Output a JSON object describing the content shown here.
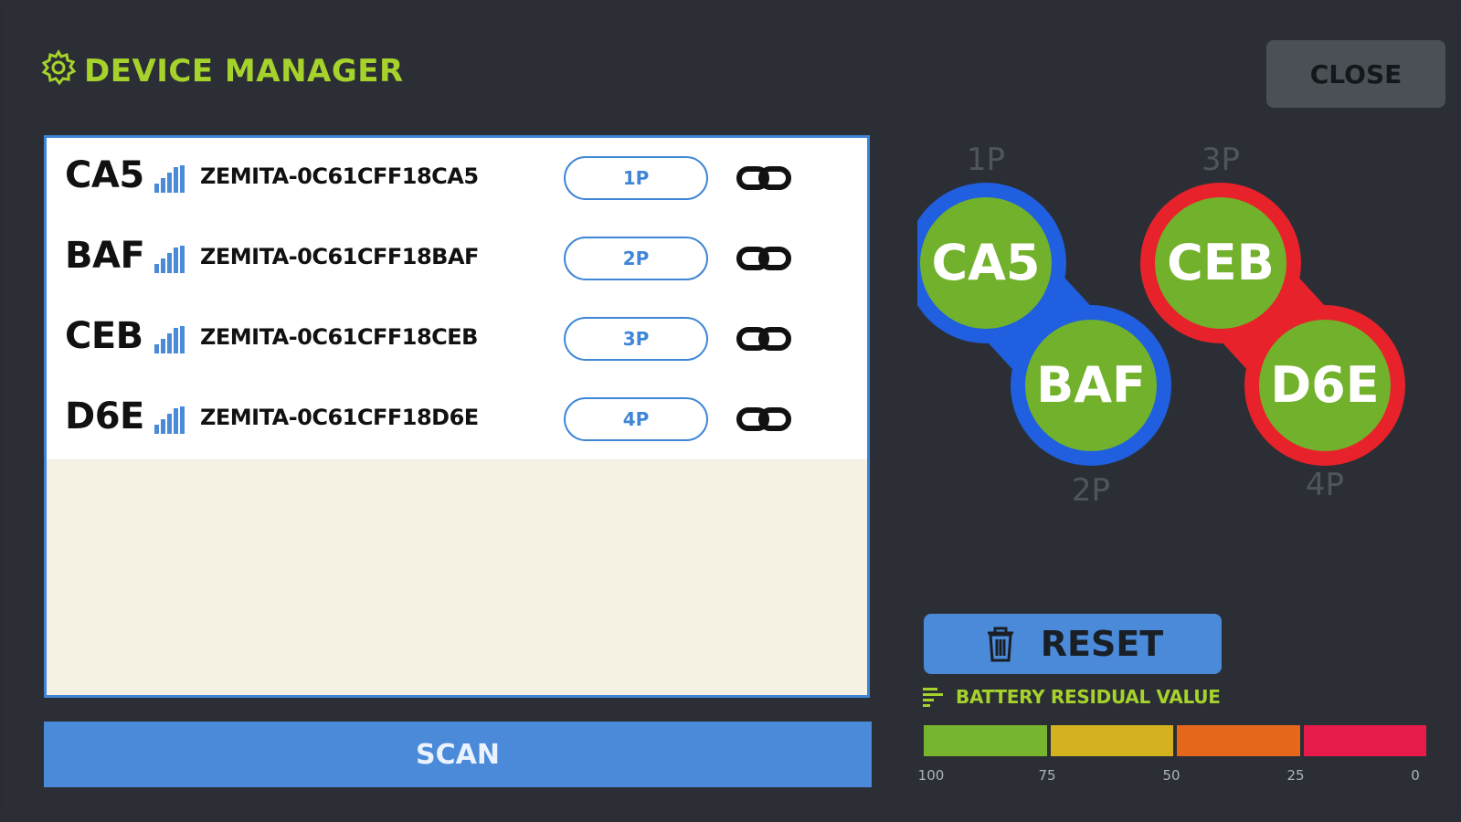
{
  "header": {
    "title": "DEVICE MANAGER",
    "close_label": "CLOSE",
    "icon": "gear-icon"
  },
  "devices": [
    {
      "short": "CA5",
      "name": "ZEMITA-0C61CFF18CA5",
      "slot": "1P"
    },
    {
      "short": "BAF",
      "name": "ZEMITA-0C61CFF18BAF",
      "slot": "2P"
    },
    {
      "short": "CEB",
      "name": "ZEMITA-0C61CFF18CEB",
      "slot": "3P"
    },
    {
      "short": "D6E",
      "name": "ZEMITA-0C61CFF18D6E",
      "slot": "4P"
    }
  ],
  "scan_label": "SCAN",
  "pairs": [
    {
      "color": "#1f5fe0",
      "top": {
        "label": "CA5",
        "player": "1P"
      },
      "bottom": {
        "label": "BAF",
        "player": "2P"
      }
    },
    {
      "color": "#e8222a",
      "top": {
        "label": "CEB",
        "player": "3P"
      },
      "bottom": {
        "label": "D6E",
        "player": "4P"
      }
    }
  ],
  "reset_label": "RESET",
  "battery": {
    "title": "BATTERY RESIDUAL VALUE",
    "segments": [
      "#78b52e",
      "#d4b21f",
      "#e5671b",
      "#e61b4a"
    ],
    "ticks": [
      "100",
      "75",
      "50",
      "25",
      "0"
    ]
  },
  "colors": {
    "accent_green": "#a6d22c",
    "accent_blue": "#4a8ad8",
    "node_green": "#72b12b"
  }
}
